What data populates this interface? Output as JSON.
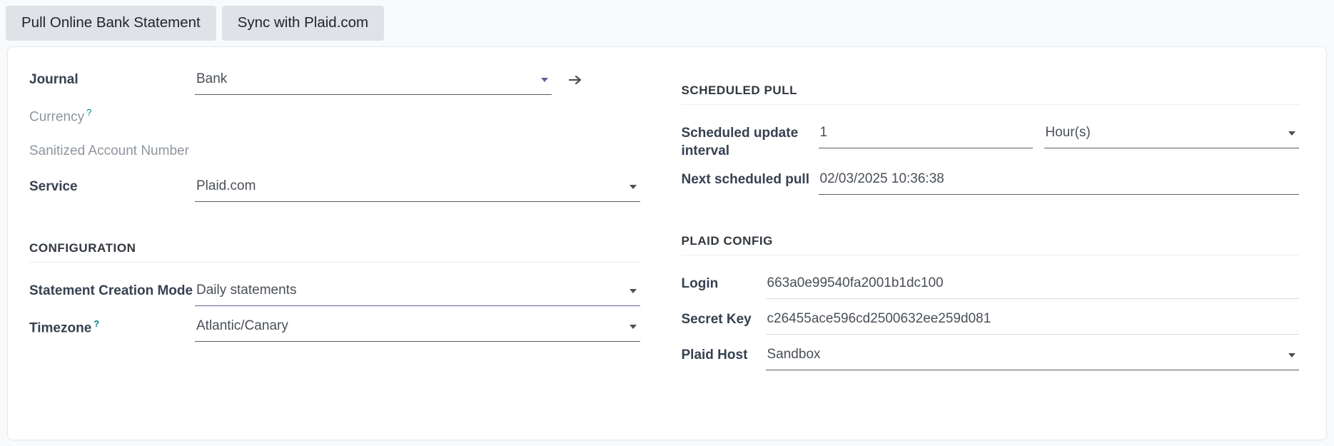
{
  "statusbar": {
    "buttons": [
      {
        "label": "Pull Online Bank Statement",
        "name": "pull-online-bank-statement-button"
      },
      {
        "label": "Sync with Plaid.com",
        "name": "sync-with-plaid-button"
      }
    ]
  },
  "left": {
    "fields": {
      "journal": {
        "label": "Journal",
        "value": "Bank",
        "caret_color": "#6a5c9c",
        "link_icon": "arrow-right-icon"
      },
      "currency": {
        "label": "Currency",
        "help": "?",
        "value": ""
      },
      "sanitized_account_number": {
        "label": "Sanitized Account Number",
        "value": ""
      },
      "service": {
        "label": "Service",
        "value": "Plaid.com"
      }
    },
    "configuration": {
      "title": "Configuration",
      "statement_creation_mode": {
        "label": "Statement Creation Mode",
        "value": "Daily statements"
      },
      "timezone": {
        "label": "Timezone",
        "help": "?",
        "value": "Atlantic/Canary"
      }
    }
  },
  "right": {
    "scheduled_pull": {
      "title": "Scheduled Pull",
      "scheduled_update_interval": {
        "label": "Scheduled update interval",
        "value": "1",
        "unit": "Hour(s)"
      },
      "next_scheduled_pull": {
        "label": "Next scheduled pull",
        "value": "02/03/2025 10:36:38"
      }
    },
    "plaid_config": {
      "title": "Plaid Config",
      "login": {
        "label": "Login",
        "value": "663a0e99540fa2001b1dc100"
      },
      "secret_key": {
        "label": "Secret Key",
        "value": "c26455ace596cd2500632ee259d081"
      },
      "plaid_host": {
        "label": "Plaid Host",
        "value": "Sandbox"
      }
    }
  },
  "theme": {
    "accent": "#6a5c9c",
    "help_icon": "#017e84",
    "button_bg": "#dfe2e7",
    "sheet_bg": "#ffffff",
    "page_bg": "#f9fafb"
  }
}
